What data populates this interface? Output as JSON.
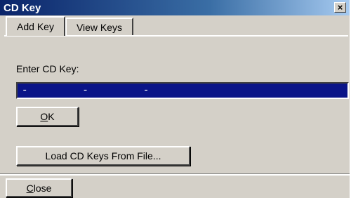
{
  "window": {
    "title": "CD Key",
    "close_glyph": "×",
    "colors": {
      "titlebar": "#0a246a",
      "face": "#d4d0c8",
      "input_bg": "#0a1488"
    }
  },
  "tabs": [
    {
      "label": "Add Key",
      "active": true
    },
    {
      "label": "View Keys",
      "active": false
    }
  ],
  "form": {
    "label": "Enter CD Key:",
    "value": "-     -     -",
    "ok_mnemonic": "O",
    "ok_rest": "K",
    "load_label": "Load CD Keys From File..."
  },
  "footer": {
    "close_mnemonic": "C",
    "close_rest": "lose"
  }
}
